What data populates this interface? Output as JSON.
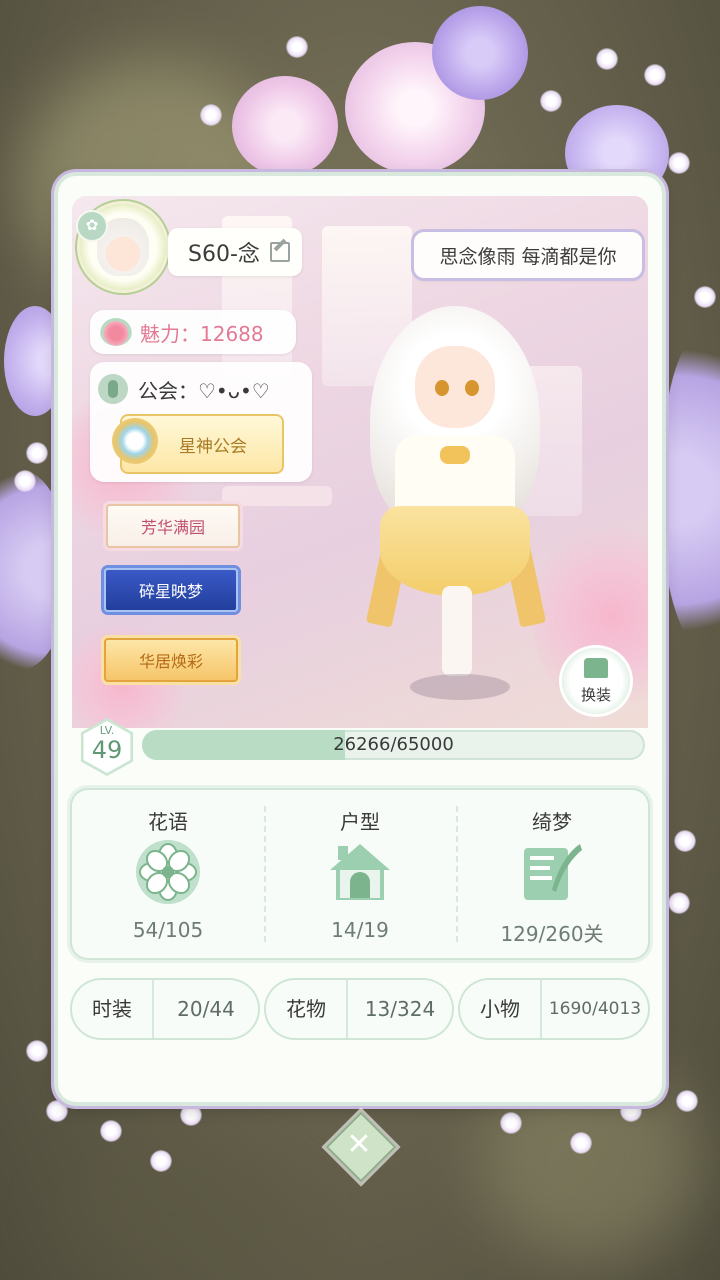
{
  "profile": {
    "name": "S60-念",
    "charm_label": "魅力：12688",
    "guild_label": "公会：♡•ᴗ•♡",
    "guild_badge": "星神公会",
    "signature": "思念像雨 每滴都是你"
  },
  "titles": [
    "芳华满园",
    "碎星映梦",
    "华居焕彩"
  ],
  "change_outfit": "换装",
  "level": {
    "label": "LV.",
    "value": "49",
    "xp_text": "26266/65000",
    "progress": 0.404
  },
  "stats": [
    {
      "title": "花语",
      "value": "54/105",
      "icon": "flower-icon"
    },
    {
      "title": "户型",
      "value": "14/19",
      "icon": "house-icon"
    },
    {
      "title": "绮梦",
      "value": "129/260关",
      "icon": "dream-book-icon"
    }
  ],
  "collections": [
    {
      "label": "时装",
      "value": "20/44"
    },
    {
      "label": "花物",
      "value": "13/324"
    },
    {
      "label": "小物",
      "value": "1690/4013"
    }
  ],
  "close_symbol": "✕",
  "colors": {
    "accent_green": "#7cb48e",
    "charm_pink": "#e37a95",
    "frame_lavender": "#c7b8e0"
  }
}
